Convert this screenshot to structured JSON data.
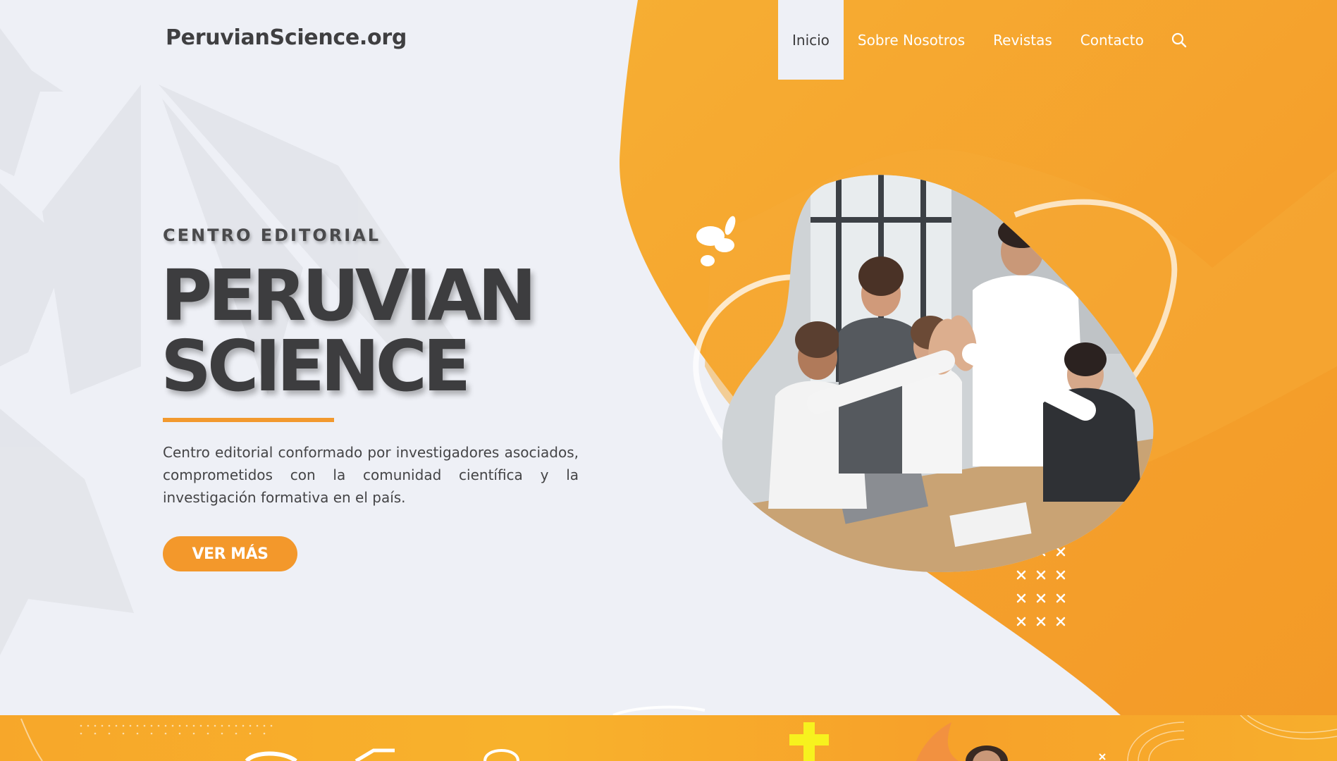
{
  "header": {
    "logo": "PeruvianScience.org",
    "nav": [
      {
        "label": "Inicio",
        "active": true
      },
      {
        "label": "Sobre Nosotros",
        "active": false
      },
      {
        "label": "Revistas",
        "active": false
      },
      {
        "label": "Contacto",
        "active": false
      }
    ],
    "search_icon": "search-icon"
  },
  "hero": {
    "eyebrow": "CENTRO EDITORIAL",
    "title_line1": "PERUVIAN",
    "title_line2": "SCIENCE",
    "description": "Centro editorial conformado por investigadores asociados, comprometidos con la comunidad científica y la investigación formativa en el país.",
    "cta": "VER MÁS",
    "photo": "team-high-five-photo"
  },
  "colors": {
    "accent": "#f3982b",
    "text_dark": "#3d3d3f",
    "background": "#eef0f6"
  }
}
